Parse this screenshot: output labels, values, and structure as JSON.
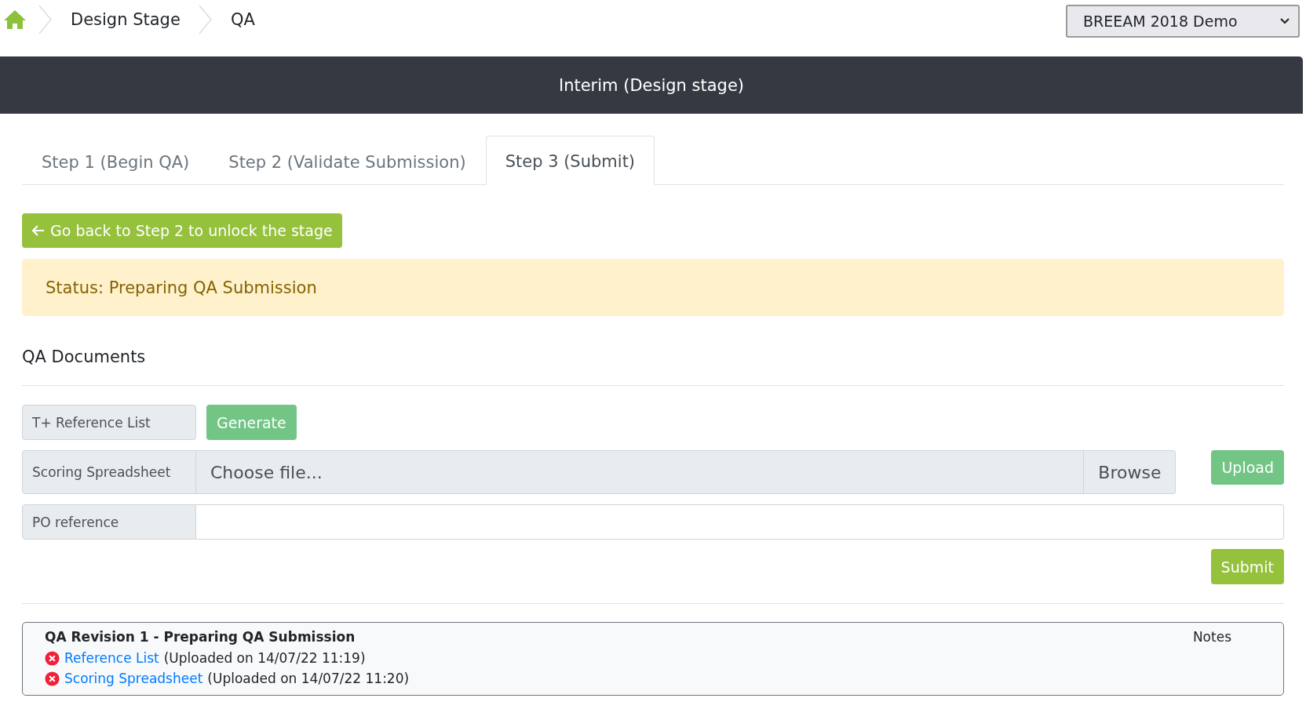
{
  "breadcrumb": [
    "Design Stage",
    "QA"
  ],
  "project_select": {
    "value": "BREEAM 2018 Demo"
  },
  "banner": {
    "title": "Interim (Design stage)"
  },
  "tabs": [
    {
      "label": "Step 1 (Begin QA)",
      "selected": false
    },
    {
      "label": "Step 2 (Validate Submission)",
      "selected": false
    },
    {
      "label": "Step 3 (Submit)",
      "selected": true
    }
  ],
  "back_button": {
    "label": "Go back to Step 2 to unlock the stage"
  },
  "status": {
    "text": "Status: Preparing QA Submission"
  },
  "section_title": "QA Documents",
  "rows": [
    {
      "kind": "generate",
      "label": "T+ Reference List",
      "button": {
        "label": "Generate",
        "disabled": true
      }
    },
    {
      "kind": "file",
      "label": "Scoring Spreadsheet",
      "placeholder": "Choose file...",
      "browse": "Browse",
      "button": {
        "label": "Upload",
        "disabled": true
      }
    },
    {
      "kind": "text",
      "label": "PO reference"
    }
  ],
  "submit_button": {
    "label": "Submit",
    "disabled": false
  },
  "revision": {
    "title": "QA Revision 1 - Preparing QA Submission",
    "notes": "Notes",
    "files": [
      {
        "link": "Reference List",
        "detail": "(Uploaded on 14/07/22 11:19)"
      },
      {
        "link": "Scoring Spreadsheet",
        "detail": "(Uploaded on 14/07/22 11:20)"
      }
    ]
  }
}
